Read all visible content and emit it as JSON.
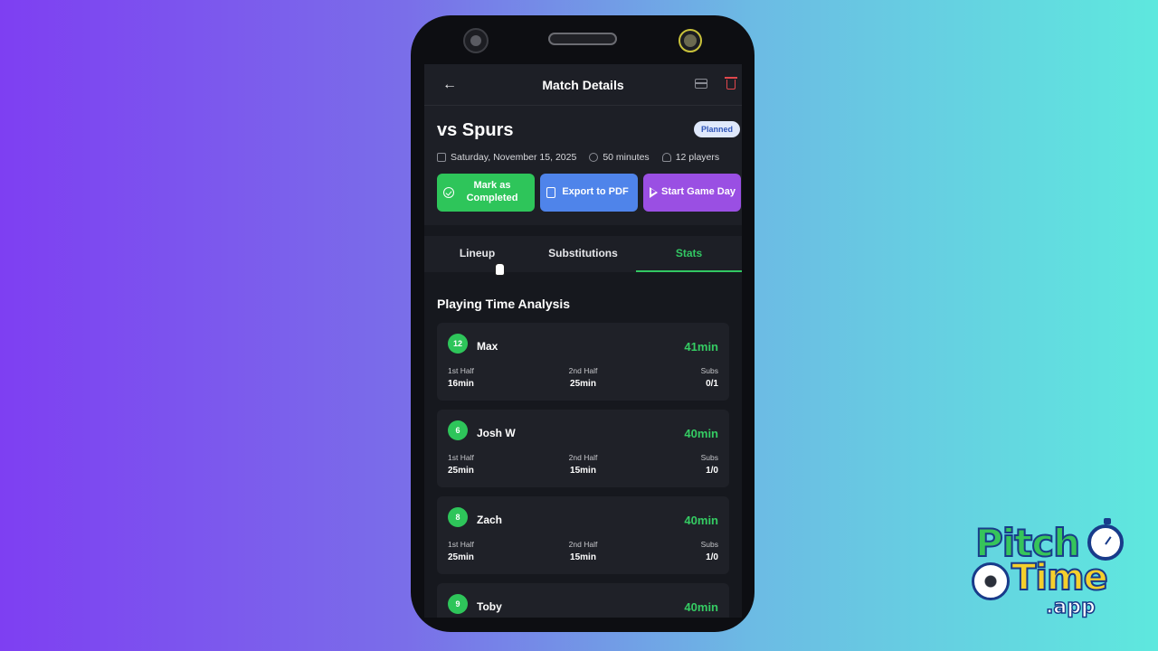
{
  "header": {
    "back_icon": "arrow-left-icon",
    "title": "Match Details",
    "card_icon": "card-icon",
    "delete_icon": "trash-icon"
  },
  "match": {
    "opponent": "vs Spurs",
    "status": "Planned",
    "date": "Saturday, November 15, 2025",
    "duration": "50 minutes",
    "players": "12 players",
    "actions": {
      "complete_label": "Mark as Completed",
      "export_label": "Export to PDF",
      "start_label": "Start Game Day"
    }
  },
  "tabs": [
    {
      "label": "Lineup"
    },
    {
      "label": "Substitutions"
    },
    {
      "label": "Stats",
      "active": true
    }
  ],
  "stats": {
    "section_title": "Playing Time Analysis",
    "first_half_label": "1st Half",
    "second_half_label": "2nd Half",
    "subs_label": "Subs",
    "players": [
      {
        "number": "12",
        "name": "Max",
        "total": "41min",
        "first_half": "16min",
        "second_half": "25min",
        "subs": "0/1"
      },
      {
        "number": "6",
        "name": "Josh W",
        "total": "40min",
        "first_half": "25min",
        "second_half": "15min",
        "subs": "1/0"
      },
      {
        "number": "8",
        "name": "Zach",
        "total": "40min",
        "first_half": "25min",
        "second_half": "15min",
        "subs": "1/0"
      },
      {
        "number": "9",
        "name": "Toby",
        "total": "40min"
      }
    ]
  },
  "logo": {
    "pitch": "Pitch",
    "time": "Time",
    "app": ".app"
  },
  "colors": {
    "accent_green": "#2ec55a",
    "accent_blue": "#4f84ea",
    "accent_purple": "#9a4fe3",
    "danger_red": "#e0474c"
  }
}
